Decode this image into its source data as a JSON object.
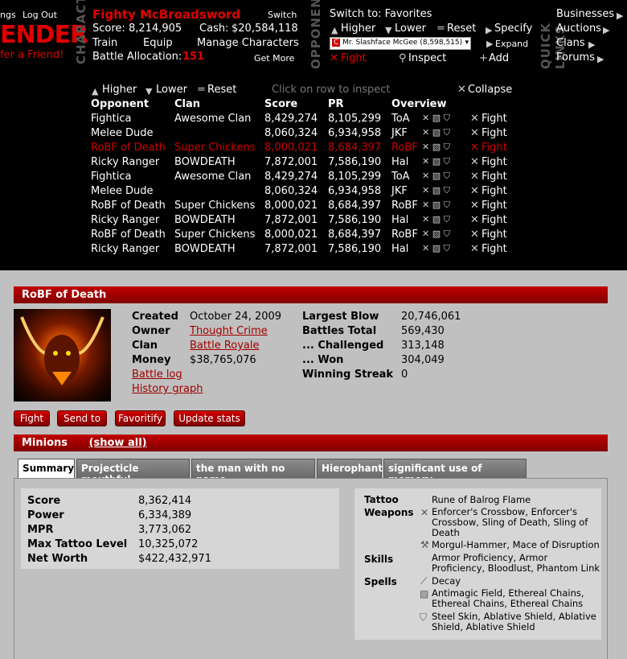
{
  "header": {
    "left_links": {
      "settings": "ngs",
      "logout": "Log Out"
    },
    "logo_text": "ENDER",
    "refer": "fer a Friend!",
    "vertical_labels": {
      "character": "CHARACTER",
      "opponents": "OPPONENTS",
      "quicklinks": "QUICK LINKS"
    },
    "character": {
      "name": "Fighty McBroadsword",
      "switch": "Switch",
      "score_label": "Score:",
      "score": "8,214,905",
      "cash_label": "Cash:",
      "cash": "$20,584,118",
      "train": "Train",
      "equip": "Equip",
      "manage": "Manage Characters",
      "alloc_label": "Battle Allocation:",
      "alloc": "151",
      "get_more": "Get More"
    },
    "opponents": {
      "switch_to": "Switch to: Favorites",
      "higher": "Higher",
      "lower": "Lower",
      "reset": "Reset",
      "specify": "Specify",
      "selected": "Mr. Slashface McGee (8,598,515)",
      "expand": "Expand",
      "fight": "Fight",
      "inspect": "Inspect",
      "add": "Add"
    },
    "quicklinks": [
      "Businesses",
      "Auctions",
      "Clans",
      "Forums"
    ]
  },
  "list_controls": {
    "higher": "Higher",
    "lower": "Lower",
    "reset": "Reset",
    "hint": "Click on row to inspect",
    "collapse": "Collapse"
  },
  "table": {
    "columns": [
      "Opponent",
      "Clan",
      "Score",
      "PR",
      "Overview"
    ],
    "rows": [
      {
        "name": "Fightica",
        "clan": "Awesome Clan",
        "score": "8,429,274",
        "pr": "8,105,299",
        "ov": "ToA",
        "fight": "Fight"
      },
      {
        "name": "Melee Dude",
        "clan": "",
        "score": "8,060,324",
        "pr": "6,934,958",
        "ov": "JKF",
        "fight": "Fight"
      },
      {
        "name": "RoBF of Death",
        "clan": "Super Chickens",
        "score": "8,000,021",
        "pr": "8,684,397",
        "ov": "RoBF",
        "fight": "Fight"
      },
      {
        "name": "Ricky Ranger",
        "clan": "BOWDEATH",
        "score": "7,872,001",
        "pr": "7,586,190",
        "ov": "Hal",
        "fight": "Fight"
      },
      {
        "name": "Fightica",
        "clan": "Awesome Clan",
        "score": "8,429,274",
        "pr": "8,105,299",
        "ov": "ToA",
        "fight": "Fight"
      },
      {
        "name": "Melee Dude",
        "clan": "",
        "score": "8,060,324",
        "pr": "6,934,958",
        "ov": "JKF",
        "fight": "Fight"
      },
      {
        "name": "RoBF of Death",
        "clan": "Super Chickens",
        "score": "8,000,021",
        "pr": "8,684,397",
        "ov": "RoBF",
        "fight": "Fight"
      },
      {
        "name": "Ricky Ranger",
        "clan": "BOWDEATH",
        "score": "7,872,001",
        "pr": "7,586,190",
        "ov": "Hal",
        "fight": "Fight"
      },
      {
        "name": "RoBF of Death",
        "clan": "Super Chickens",
        "score": "8,000,021",
        "pr": "8,684,397",
        "ov": "RoBF",
        "fight": "Fight"
      },
      {
        "name": "Ricky Ranger",
        "clan": "BOWDEATH",
        "score": "7,872,001",
        "pr": "7,586,190",
        "ov": "Hal",
        "fight": "Fight"
      }
    ]
  },
  "profile": {
    "title": "RoBF of Death",
    "created_label": "Created",
    "created": "October 24, 2009",
    "owner_label": "Owner",
    "owner": "Thought Crime",
    "clan_label": "Clan",
    "clan": "Battle Royale",
    "money_label": "Money",
    "money": "$38,765,076",
    "battle_log": "Battle log",
    "history": "History graph",
    "largest_label": "Largest Blow",
    "largest": "20,746,061",
    "total_label": "Battles Total",
    "total": "569,430",
    "chal_label": "... Challenged",
    "chal": "313,148",
    "won_label": "... Won",
    "won": "304,049",
    "streak_label": "Winning Streak",
    "streak": "0",
    "buttons": [
      "Fight",
      "Send to",
      "Favoritify",
      "Update stats"
    ]
  },
  "minions": {
    "title": "Minions",
    "show_all": "(show all)",
    "tabs": [
      "Summary",
      "Projecticle mouthful",
      "the man with no name",
      "Hierophant",
      "significant use of memory"
    ],
    "stats": [
      {
        "k": "Score",
        "v": "8,362,414"
      },
      {
        "k": "Power",
        "v": "6,334,389"
      },
      {
        "k": "MPR",
        "v": "3,773,062"
      },
      {
        "k": "Max Tattoo Level",
        "v": "10,325,072"
      },
      {
        "k": "Net Worth",
        "v": "$422,432,971"
      }
    ],
    "tattoo_label": "Tattoo",
    "tattoo": "Rune of Balrog Flame",
    "weapons_label": "Weapons",
    "weapons1": "Enforcer's Crossbow, Enforcer's Crossbow, Sling of Death, Sling of Death",
    "weapons2": "Morgul-Hammer, Mace of Disruption",
    "skills_label": "Skills",
    "skills": "Armor Proficiency, Armor Proficiency, Bloodlust, Phantom Link",
    "spells_label": "Spells",
    "spells1": "Decay",
    "spells2": "Antimagic Field, Ethereal Chains, Ethereal Chains, Ethereal Chains",
    "spells3": "Steel Skin, Ablative Shield, Ablative Shield, Ablative Shield"
  },
  "colors": {
    "accent": "#c00000",
    "header_bg": "#000000",
    "page_bg": "#c0c0c0"
  }
}
